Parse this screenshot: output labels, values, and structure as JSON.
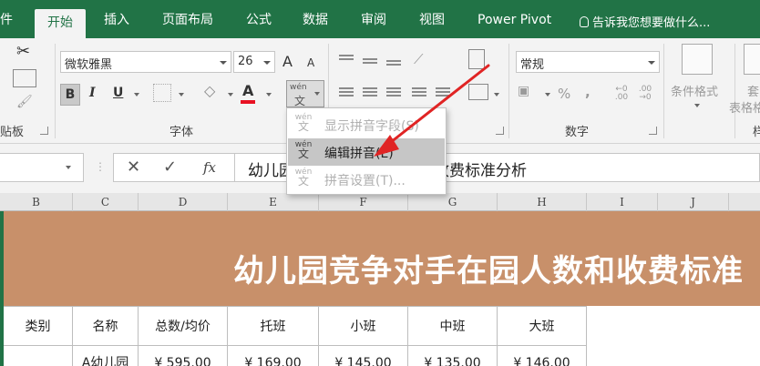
{
  "ribbon_tabs": [
    "件",
    "开始",
    "插入",
    "页面布局",
    "公式",
    "数据",
    "审阅",
    "视图",
    "Power Pivot"
  ],
  "tell_me": "告诉我您想要做什么...",
  "clipboard": {
    "label": "贴板"
  },
  "font": {
    "name": "微软雅黑",
    "size": "26",
    "grow_label": "A",
    "shrink_label": "A",
    "bold": "B",
    "italic": "I",
    "underline": "U",
    "font_color_label": "A",
    "font_color": "#e81123",
    "phonetic_label": "wén",
    "phonetic_sub": "文",
    "group_label": "字体"
  },
  "number": {
    "format": "常规",
    "percent": "%",
    "comma": ",",
    "inc": "←0 .00",
    "dec": ".00 →0",
    "group_label": "数字"
  },
  "styles": {
    "cond_format": "条件格式",
    "table_format_a": "套",
    "table_format_b": "表格格",
    "group_partial": "样"
  },
  "menu": {
    "items": [
      {
        "label": "显示拼音字段(S)",
        "icon_top": "wén",
        "icon_bottom": "文",
        "state": "disabled"
      },
      {
        "label": "编辑拼音(E)",
        "icon_top": "wén",
        "icon_bottom": "文",
        "state": "highlighted"
      },
      {
        "label": "拼音设置(T)...",
        "icon_top": "wén",
        "icon_bottom": "文",
        "state": "disabled"
      }
    ]
  },
  "formula_bar": {
    "cancel": "✕",
    "enter": "✓",
    "fx": "fx",
    "text": "幼儿园竞争对手在园人数和收费标准分析"
  },
  "columns": [
    "B",
    "C",
    "D",
    "E",
    "F",
    "G",
    "H",
    "I",
    "J"
  ],
  "sheet": {
    "title": "幼儿园竞争对手在园人数和收费标准",
    "title_fill": "#c8906a",
    "headers": [
      "类别",
      "名称",
      "总数/均价",
      "托班",
      "小班",
      "中班",
      "大班"
    ],
    "row1": [
      "",
      "A幼儿园",
      "¥ 595.00",
      "¥ 169.00",
      "¥ 145.00",
      "¥ 135.00",
      "¥ 146.00"
    ]
  },
  "accent": "#217346"
}
